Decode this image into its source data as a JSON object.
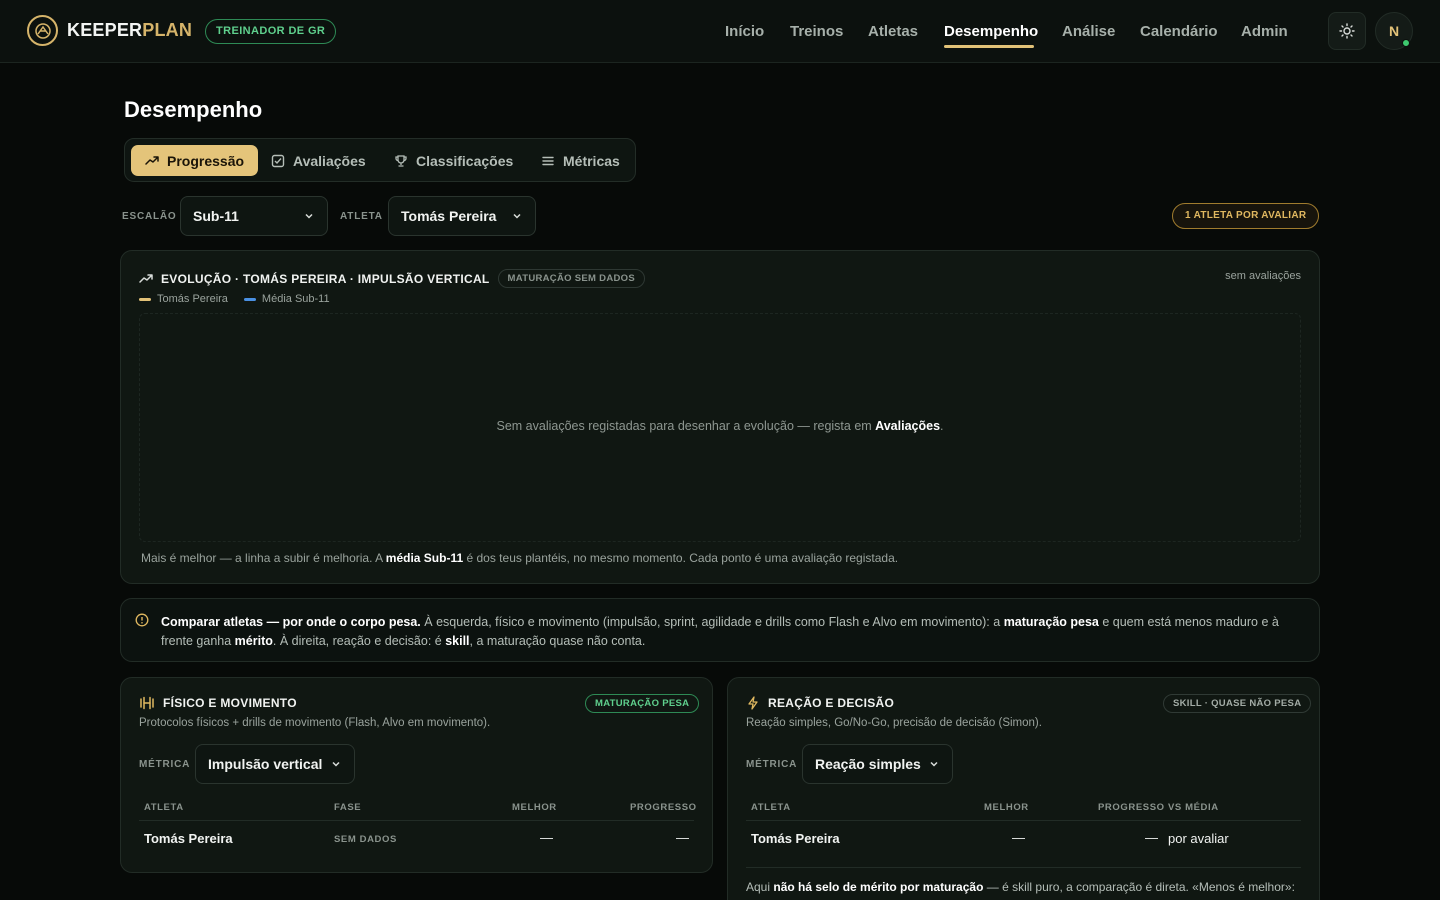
{
  "app": {
    "brand_part1": "KEEPER",
    "brand_part2": "PLAN",
    "role": "TREINADOR DE GR"
  },
  "nav": [
    "Início",
    "Treinos",
    "Atletas",
    "Desempenho",
    "Análise",
    "Calendário",
    "Admin"
  ],
  "nav_active": "Desempenho",
  "user": {
    "initial": "N",
    "status_color": "#3ec96f"
  },
  "page": {
    "title": "Desempenho"
  },
  "tabs": [
    {
      "label": "Progressão",
      "icon": "trending-up-icon"
    },
    {
      "label": "Avaliações",
      "icon": "checkbox-icon"
    },
    {
      "label": "Classificações",
      "icon": "trophy-icon"
    },
    {
      "label": "Métricas",
      "icon": "list-icon"
    }
  ],
  "filters": {
    "squad_label": "ESCALÃO",
    "squad_value": "Sub-11",
    "athlete_label": "ATLETA",
    "athlete_value": "Tomás Pereira",
    "pending": "1 ATLETA POR AVALIAR"
  },
  "evolution": {
    "title": "EVOLUÇÃO · TOMÁS PEREIRA · IMPULSÃO VERTICAL",
    "tag": "MATURAÇÃO SEM DADOS",
    "status": "sem avaliações",
    "legend": [
      {
        "name": "Tomás Pereira",
        "color": "#e2c278"
      },
      {
        "name": "Média Sub-11",
        "color": "#4a90e2"
      }
    ],
    "empty_text": "Sem avaliações registadas para desenhar a evolução — regista em ",
    "empty_link": "Avaliações",
    "empty_end": ".",
    "footnote_1": "Mais é melhor — a linha a subir é melhoria. A ",
    "footnote_strong": "média Sub-11",
    "footnote_2": " é dos teus plantéis, no mesmo momento. Cada ponto é uma avaliação registada."
  },
  "compare": {
    "strong1": "Comparar atletas — por onde o corpo pesa.",
    "text1": " À esquerda, físico e movimento (impulsão, sprint, agilidade e drills como Flash e Alvo em movimento): a ",
    "strong2": "maturação pesa",
    "text2": " e quem está menos maduro e à frente ganha ",
    "strong3": "mérito",
    "text3": ". À direita, reação e decisão: é ",
    "strong4": "skill",
    "text4": ", a maturação quase não conta."
  },
  "physical": {
    "title": "FÍSICO E MOVIMENTO",
    "tag": "MATURAÇÃO PESA",
    "subtitle": "Protocolos físicos + drills de movimento (Flash, Alvo em movimento).",
    "metric_label": "MÉTRICA",
    "metric_value": "Impulsão vertical",
    "headers": [
      "ATLETA",
      "FASE",
      "MELHOR",
      "PROGRESSO"
    ],
    "row": {
      "athlete": "Tomás Pereira",
      "phase": "SEM DADOS",
      "best": "—",
      "progress": "—"
    }
  },
  "reaction": {
    "title": "REAÇÃO E DECISÃO",
    "tag": "SKILL · QUASE NÃO PESA",
    "subtitle": "Reação simples, Go/No-Go, precisão de decisão (Simon).",
    "metric_label": "MÉTRICA",
    "metric_value": "Reação simples",
    "headers": [
      "ATLETA",
      "MELHOR",
      "PROGRESSO",
      "VS MÉDIA"
    ],
    "row": {
      "athlete": "Tomás Pereira",
      "best": "—",
      "progress": "—",
      "vs_avg": "por avaliar"
    },
    "note_1": "Aqui ",
    "note_strong": "não há selo de mérito por maturação",
    "note_2": " — é skill puro, a comparação é direta. «Menos é melhor»:"
  }
}
